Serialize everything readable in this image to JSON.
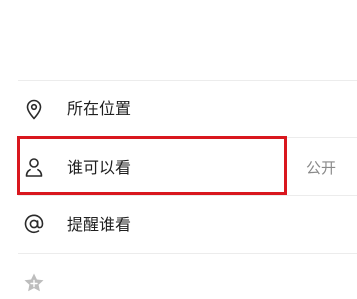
{
  "settings": {
    "location": {
      "label": "所在位置",
      "icon": "location-pin-icon"
    },
    "visibility": {
      "label": "谁可以看",
      "value": "公开",
      "icon": "person-icon"
    },
    "mention": {
      "label": "提醒谁看",
      "icon": "at-icon"
    },
    "partial_item": {
      "icon": "star-icon"
    }
  },
  "colors": {
    "highlight": "#d9171e",
    "text": "#1f1f1f",
    "secondary_text": "#8a8a8a",
    "icon": "#2a2a2a",
    "divider": "#ececec"
  }
}
